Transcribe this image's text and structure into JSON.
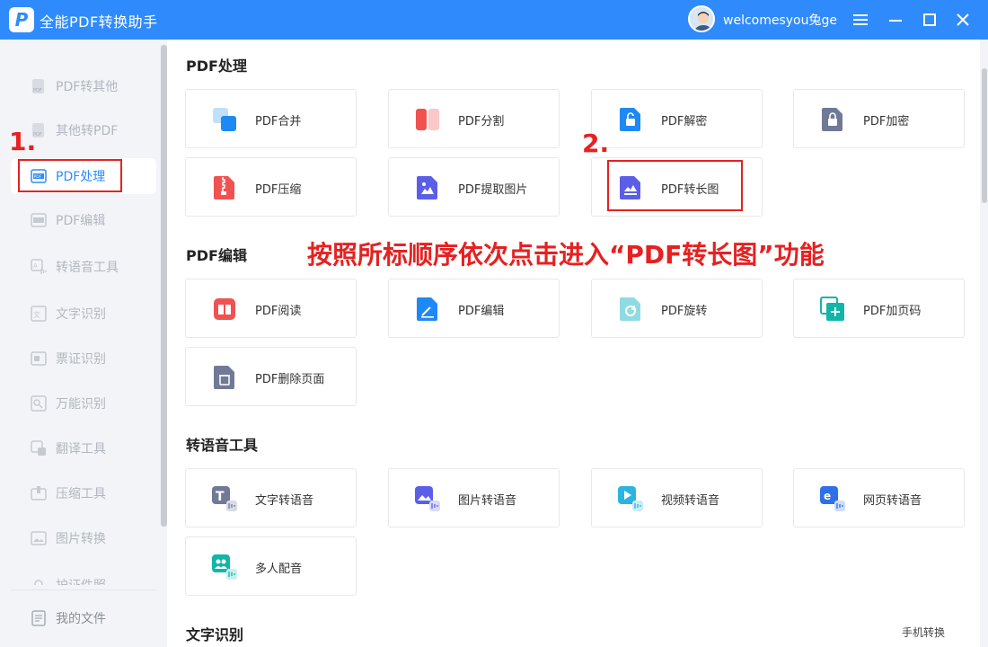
{
  "app": {
    "title": "全能PDF转换助手",
    "username": "welcomesyou兔ge"
  },
  "sidebar": {
    "items": [
      {
        "label": "PDF转其他",
        "icon": "pdf-export-icon"
      },
      {
        "label": "其他转PDF",
        "icon": "pdf-import-icon"
      },
      {
        "label": "PDF处理",
        "icon": "pdf-process-icon",
        "active": true
      },
      {
        "label": "PDF编辑",
        "icon": "pdf-edit-icon"
      },
      {
        "label": "转语音工具",
        "icon": "speech-icon"
      },
      {
        "label": "文字识别",
        "icon": "text-ocr-icon"
      },
      {
        "label": "票证识别",
        "icon": "ticket-ocr-icon"
      },
      {
        "label": "万能识别",
        "icon": "universal-ocr-icon"
      },
      {
        "label": "翻译工具",
        "icon": "translate-icon"
      },
      {
        "label": "压缩工具",
        "icon": "compress-icon"
      },
      {
        "label": "图片转换",
        "icon": "image-convert-icon"
      },
      {
        "label": "护证件照",
        "icon": "id-photo-icon"
      }
    ],
    "my_files": "我的文件"
  },
  "sections": {
    "pdf_process": {
      "title": "PDF处理",
      "cards": [
        "PDF合并",
        "PDF分割",
        "PDF解密",
        "PDF加密",
        "PDF压缩",
        "PDF提取图片",
        "PDF转长图"
      ]
    },
    "pdf_edit": {
      "title": "PDF编辑",
      "cards": [
        "PDF阅读",
        "PDF编辑",
        "PDF旋转",
        "PDF加页码",
        "PDF删除页面"
      ]
    },
    "speech": {
      "title": "转语音工具",
      "cards": [
        "文字转语音",
        "图片转语音",
        "视频转语音",
        "网页转语音",
        "多人配音"
      ]
    },
    "ocr": {
      "title": "文字识别",
      "phone_convert": "手机转换"
    }
  },
  "annotations": {
    "step1": "1.",
    "step2": "2.",
    "instruction": "按照所标顺序依次点击进入“PDF转长图”功能"
  },
  "colors": {
    "accent": "#2f8bfb",
    "annotation": "#e62121"
  }
}
